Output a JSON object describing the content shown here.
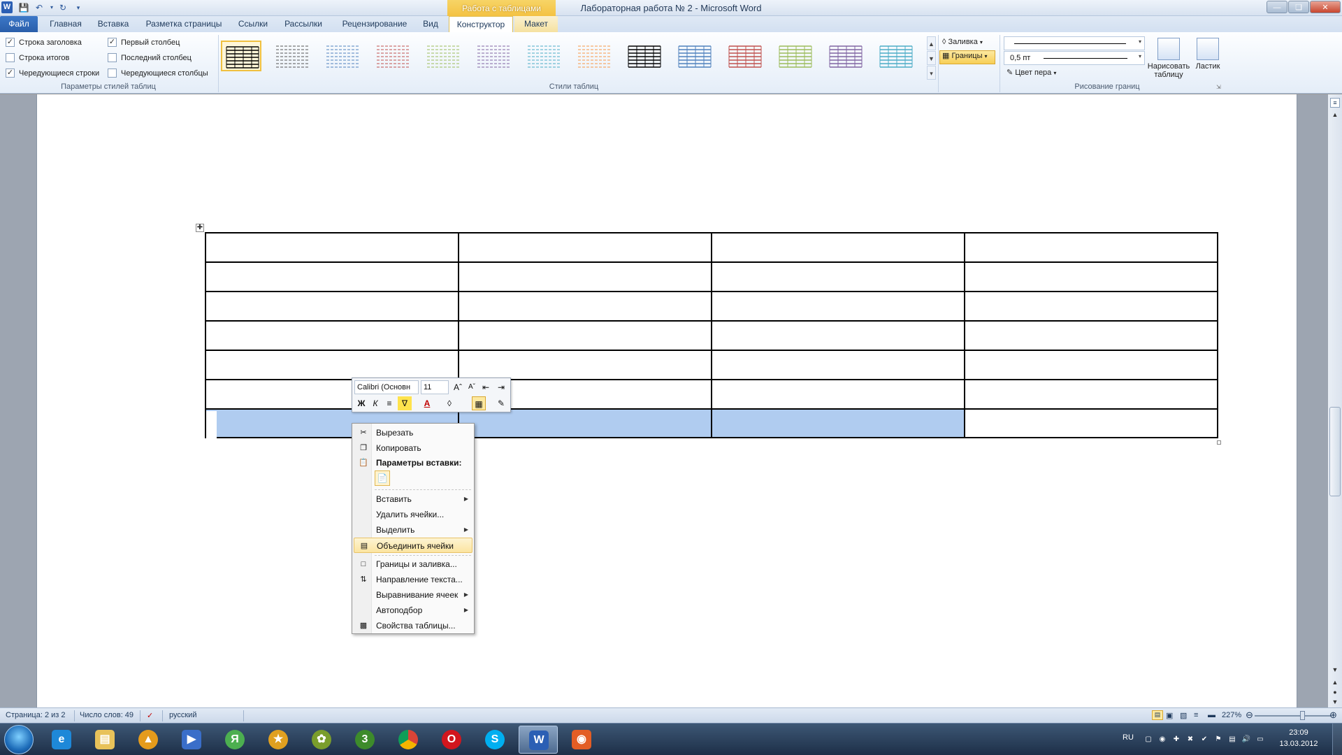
{
  "window": {
    "title": "Лабораторная работа № 2  -  Microsoft Word",
    "context_group": "Работа с таблицами"
  },
  "tabs": [
    "Файл",
    "Главная",
    "Вставка",
    "Разметка страницы",
    "Ссылки",
    "Рассылки",
    "Рецензирование",
    "Вид",
    "Конструктор",
    "Макет"
  ],
  "ribbon": {
    "style_options": {
      "label": "Параметры стилей таблиц",
      "items": [
        {
          "label": "Строка заголовка",
          "checked": true
        },
        {
          "label": "Строка итогов",
          "checked": false
        },
        {
          "label": "Чередующиеся строки",
          "checked": true
        },
        {
          "label": "Первый столбец",
          "checked": true
        },
        {
          "label": "Последний столбец",
          "checked": false
        },
        {
          "label": "Чередующиеся столбцы",
          "checked": false
        }
      ]
    },
    "table_styles": {
      "label": "Стили таблиц",
      "colors": [
        "#000000",
        "#555555",
        "#4f81bd",
        "#c0504d",
        "#9bbb59",
        "#8064a2",
        "#4bacc6",
        "#f79646",
        "#000000",
        "#4f81bd",
        "#c0504d",
        "#9bbb59",
        "#8064a2",
        "#4bacc6"
      ]
    },
    "shading_label": "Заливка",
    "borders_label": "Границы",
    "draw_borders": {
      "label": "Рисование границ",
      "line_width": "0,5 пт",
      "pen_color_label": "Цвет пера",
      "draw_table_label": "Нарисовать таблицу",
      "eraser_label": "Ластик"
    }
  },
  "table": {
    "rows": 7,
    "cols": 4,
    "selected_last_row_cells": [
      true,
      true,
      true,
      false
    ]
  },
  "mini_toolbar": {
    "font": "Calibri (Основн",
    "size": "11",
    "bold": "Ж",
    "italic": "К",
    "font_color": "A"
  },
  "context_menu": {
    "items": [
      {
        "label": "Вырезать",
        "icon": "scissors-icon"
      },
      {
        "label": "Копировать",
        "icon": "copy-icon"
      },
      {
        "label": "Параметры вставки:",
        "icon": "paste-icon"
      },
      {
        "label": "Вставить",
        "submenu": true
      },
      {
        "label": "Удалить ячейки..."
      },
      {
        "label": "Выделить",
        "submenu": true
      },
      {
        "label": "Объединить ячейки",
        "icon": "merge-cells-icon",
        "highlighted": true
      },
      {
        "label": "Границы и заливка...",
        "icon": "borders-icon"
      },
      {
        "label": "Направление текста...",
        "icon": "text-direction-icon"
      },
      {
        "label": "Выравнивание ячеек",
        "submenu": true
      },
      {
        "label": "Автоподбор",
        "submenu": true
      },
      {
        "label": "Свойства таблицы...",
        "icon": "table-properties-icon"
      }
    ]
  },
  "status": {
    "page": "Страница: 2 из 2",
    "words": "Число слов: 49",
    "language": "русский",
    "zoom": "227%"
  },
  "taskbar": {
    "lang": "RU",
    "time": "23:09",
    "date": "13.03.2012"
  }
}
